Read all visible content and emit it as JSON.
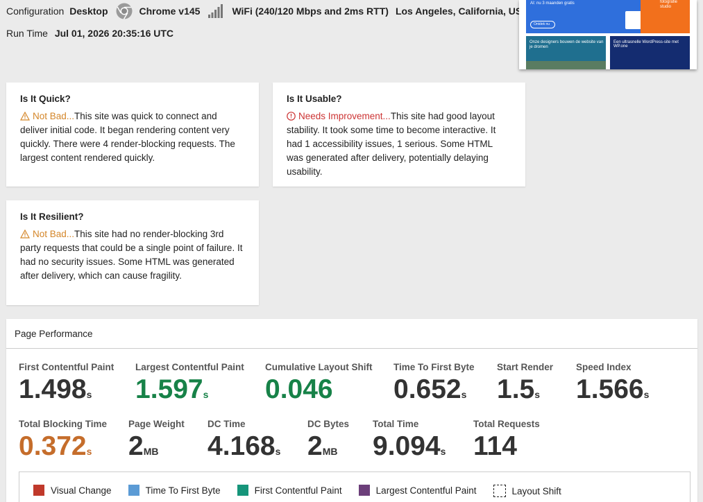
{
  "header": {
    "config_label": "Configuration",
    "config_device": "Desktop",
    "browser": "Chrome v145",
    "connection": "WiFi (240/120 Mbps and 2ms RTT)",
    "location": "Los Angeles, California, USA",
    "run_time_label": "Run Time",
    "run_time_value": "Jul 01, 2026 20:35:16 UTC"
  },
  "thumbnail": {
    "banner_text": "AI: nu 3 maanden gratis",
    "button_text": "Ontdek nu",
    "orange_text": "fotografie studio",
    "tile1_text": "Onze designers bouwen de website van je dromen",
    "tile2_text": "Een ultrasnelle WordPress-site met WP.one"
  },
  "cards": {
    "quick": {
      "title": "Is It Quick?",
      "status": "Not Bad...",
      "text": "This site was quick to connect and deliver initial code. It began rendering content very quickly. There were 4 render-blocking requests. The largest content rendered quickly."
    },
    "usable": {
      "title": "Is It Usable?",
      "status": "Needs Improvement...",
      "text": "This site had good layout stability. It took some time to become interactive. It had 1 accessibility issues, 1 serious. Some HTML was generated after delivery, potentially delaying usability."
    },
    "resilient": {
      "title": "Is It Resilient?",
      "status": "Not Bad...",
      "text": "This site had no render-blocking 3rd party requests that could be a single point of failure. It had no security issues. Some HTML was generated after delivery, which can cause fragility."
    }
  },
  "performance": {
    "title": "Page Performance",
    "metrics": [
      {
        "label": "First Contentful Paint",
        "value": "1.498",
        "unit": "s"
      },
      {
        "label": "Largest Contentful Paint",
        "value": "1.597",
        "unit": "s"
      },
      {
        "label": "Cumulative Layout Shift",
        "value": "0.046",
        "unit": ""
      },
      {
        "label": "Time To First Byte",
        "value": "0.652",
        "unit": "s"
      },
      {
        "label": "Start Render",
        "value": "1.5",
        "unit": "s"
      },
      {
        "label": "Speed Index",
        "value": "1.566",
        "unit": "s"
      },
      {
        "label": "Total Blocking Time",
        "value": "0.372",
        "unit": "s"
      },
      {
        "label": "Page Weight",
        "value": "2",
        "unit": "MB"
      },
      {
        "label": "DC Time",
        "value": "4.168",
        "unit": "s"
      },
      {
        "label": "DC Bytes",
        "value": "2",
        "unit": "MB"
      },
      {
        "label": "Total Time",
        "value": "9.094",
        "unit": "s"
      },
      {
        "label": "Total Requests",
        "value": "114",
        "unit": ""
      }
    ],
    "legend": [
      {
        "label": "Visual Change",
        "color": "#c0392b"
      },
      {
        "label": "Time To First Byte",
        "color": "#5b9bd5"
      },
      {
        "label": "First Contentful Paint",
        "color": "#16957a"
      },
      {
        "label": "Largest Contentful Paint",
        "color": "#6c3f7a"
      },
      {
        "label": "Layout Shift",
        "color": "dashed"
      }
    ]
  },
  "colors": {
    "warning": "#d48629",
    "error": "#cc3333",
    "good": "#178248",
    "needs_work": "#c56d2b"
  }
}
